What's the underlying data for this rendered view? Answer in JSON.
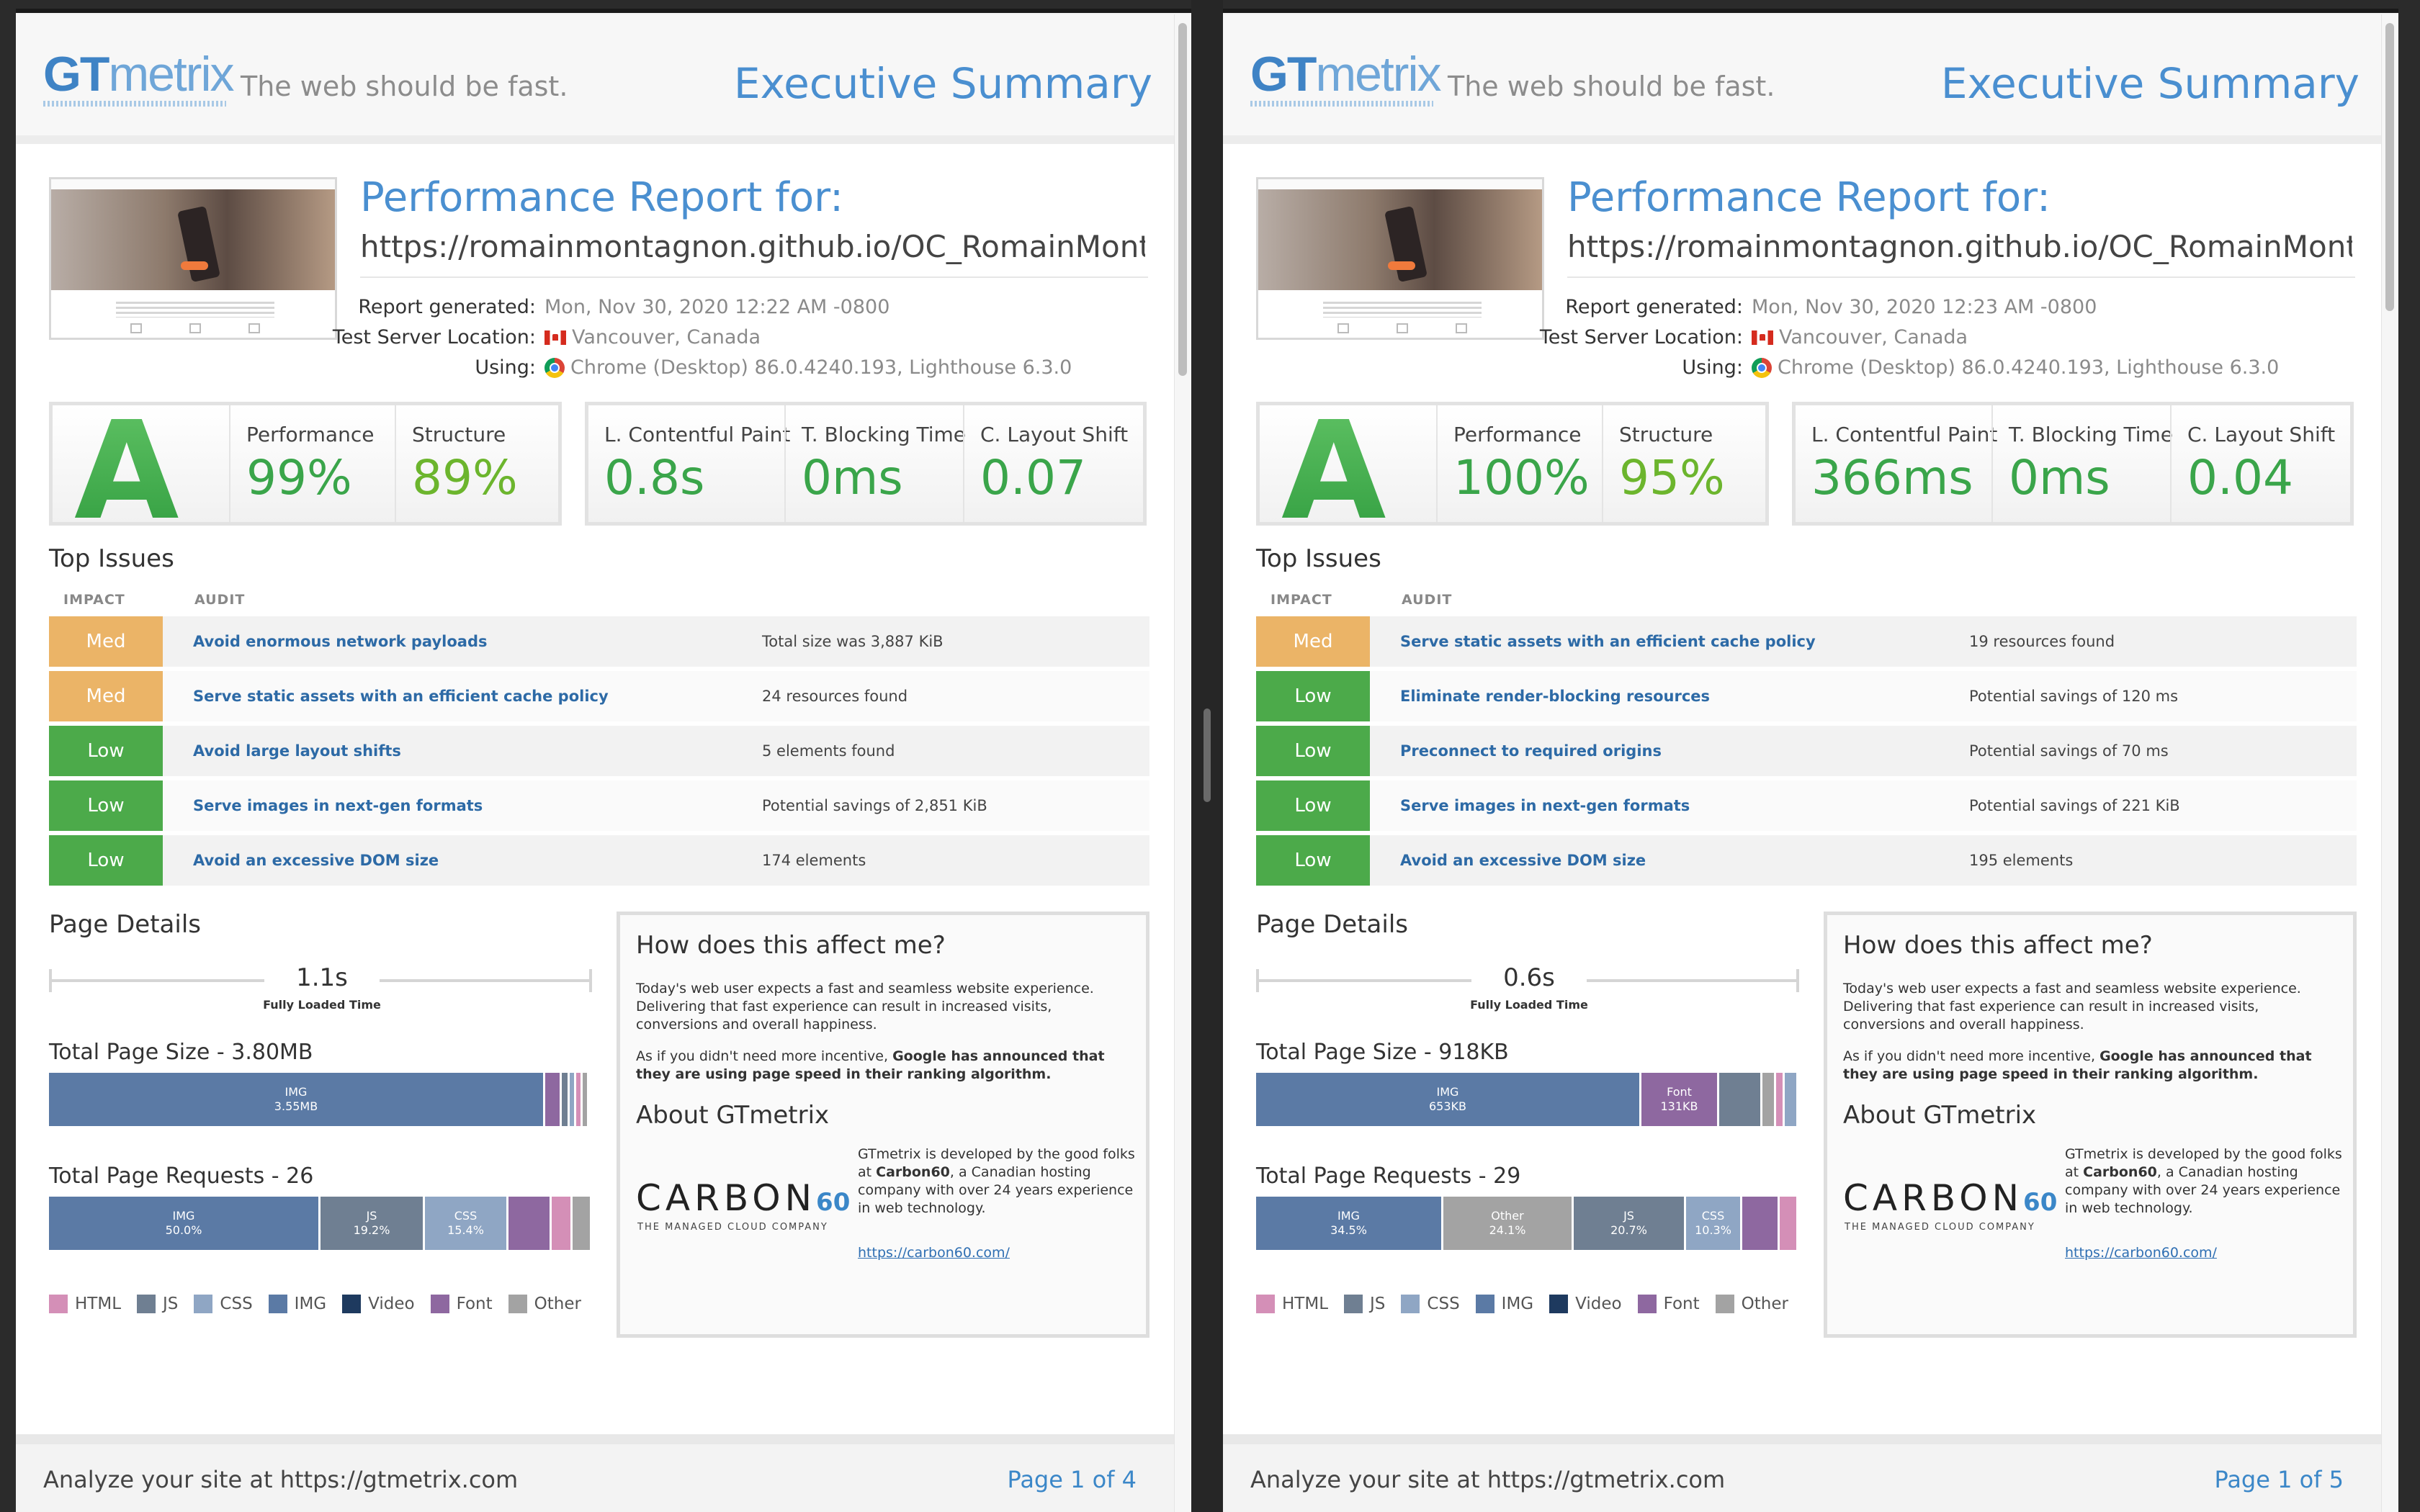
{
  "reports": [
    {
      "header": {
        "logo_gt": "GT",
        "logo_metrix": "metrix",
        "tagline": "The web should be fast.",
        "exec_title": "Executive Summary"
      },
      "report": {
        "title": "Performance Report for:",
        "url": "https://romainmontagnon.github.io/OC_RomainMontagnon_...",
        "generated_label": "Report generated:",
        "generated": "Mon, Nov 30, 2020 12:22 AM -0800",
        "location_label": "Test Server Location:",
        "location": "Vancouver, Canada",
        "using_label": "Using:",
        "using": "Chrome (Desktop) 86.0.4240.193, Lighthouse 6.3.0"
      },
      "grade": "A",
      "scores": {
        "performance_label": "Performance",
        "performance": "99%",
        "structure_label": "Structure",
        "structure": "89%"
      },
      "vitals": {
        "lcp_label": "L. Contentful Paint",
        "lcp": "0.8s",
        "tbt_label": "T. Blocking Time",
        "tbt": "0ms",
        "cls_label": "C. Layout Shift",
        "cls": "0.07"
      },
      "top_issues": {
        "title": "Top Issues",
        "impact_header": "IMPACT",
        "audit_header": "AUDIT",
        "rows": [
          {
            "impact": "Med",
            "audit": "Avoid enormous network payloads",
            "detail": "Total size was 3,887 KiB"
          },
          {
            "impact": "Med",
            "audit": "Serve static assets with an efficient cache policy",
            "detail": "24 resources found"
          },
          {
            "impact": "Low",
            "audit": "Avoid large layout shifts",
            "detail": "5 elements found"
          },
          {
            "impact": "Low",
            "audit": "Serve images in next-gen formats",
            "detail": "Potential savings of 2,851 KiB"
          },
          {
            "impact": "Low",
            "audit": "Avoid an excessive DOM size",
            "detail": "174 elements"
          }
        ]
      },
      "page_details": {
        "title": "Page Details",
        "fully_loaded": "1.1s",
        "fully_loaded_label": "Fully Loaded Time",
        "size_title": "Total Page Size - 3.80MB",
        "requests_title": "Total Page Requests - 26"
      },
      "info": {
        "affect_title": "How does this affect me?",
        "affect_p1": "Today's web user expects a fast and seamless website experience. Delivering that fast experience can result in increased visits, conversions and overall happiness.",
        "affect_p2_a": "As if you didn't need more incentive, ",
        "affect_p2_b": "Google has announced that they are using page speed in their ranking algorithm.",
        "about_title": "About GTmetrix",
        "carbon": "CARBON",
        "carbon_num": "60",
        "carbon_sub": "THE MANAGED CLOUD COMPANY",
        "about_a": "GTmetrix is developed by the good folks at ",
        "about_b": "Carbon60",
        "about_c": ", a Canadian hosting company with over 24 years experience in web technology.",
        "link": "https://carbon60.com/"
      },
      "footer": {
        "left": "Analyze your site at https://gtmetrix.com",
        "right": "Page 1 of 4"
      }
    },
    {
      "header": {
        "logo_gt": "GT",
        "logo_metrix": "metrix",
        "tagline": "The web should be fast.",
        "exec_title": "Executive Summary"
      },
      "report": {
        "title": "Performance Report for:",
        "url": "https://romainmontagnon.github.io/OC_RomainMontagnon_...",
        "generated_label": "Report generated:",
        "generated": "Mon, Nov 30, 2020 12:23 AM -0800",
        "location_label": "Test Server Location:",
        "location": "Vancouver, Canada",
        "using_label": "Using:",
        "using": "Chrome (Desktop) 86.0.4240.193, Lighthouse 6.3.0"
      },
      "grade": "A",
      "scores": {
        "performance_label": "Performance",
        "performance": "100%",
        "structure_label": "Structure",
        "structure": "95%"
      },
      "vitals": {
        "lcp_label": "L. Contentful Paint",
        "lcp": "366ms",
        "tbt_label": "T. Blocking Time",
        "tbt": "0ms",
        "cls_label": "C. Layout Shift",
        "cls": "0.04"
      },
      "top_issues": {
        "title": "Top Issues",
        "impact_header": "IMPACT",
        "audit_header": "AUDIT",
        "rows": [
          {
            "impact": "Med",
            "audit": "Serve static assets with an efficient cache policy",
            "detail": "19 resources found"
          },
          {
            "impact": "Low",
            "audit": "Eliminate render-blocking resources",
            "detail": "Potential savings of 120 ms"
          },
          {
            "impact": "Low",
            "audit": "Preconnect to required origins",
            "detail": "Potential savings of 70 ms"
          },
          {
            "impact": "Low",
            "audit": "Serve images in next-gen formats",
            "detail": "Potential savings of 221 KiB"
          },
          {
            "impact": "Low",
            "audit": "Avoid an excessive DOM size",
            "detail": "195 elements"
          }
        ]
      },
      "page_details": {
        "title": "Page Details",
        "fully_loaded": "0.6s",
        "fully_loaded_label": "Fully Loaded Time",
        "size_title": "Total Page Size - 918KB",
        "requests_title": "Total Page Requests - 29"
      },
      "info": {
        "affect_title": "How does this affect me?",
        "affect_p1": "Today's web user expects a fast and seamless website experience. Delivering that fast experience can result in increased visits, conversions and overall happiness.",
        "affect_p2_a": "As if you didn't need more incentive, ",
        "affect_p2_b": "Google has announced that they are using page speed in their ranking algorithm.",
        "about_title": "About GTmetrix",
        "carbon": "CARBON",
        "carbon_num": "60",
        "carbon_sub": "THE MANAGED CLOUD COMPANY",
        "about_a": "GTmetrix is developed by the good folks at ",
        "about_b": "Carbon60",
        "about_c": ", a Canadian hosting company with over 24 years experience in web technology.",
        "link": "https://carbon60.com/"
      },
      "footer": {
        "left": "Analyze your site at https://gtmetrix.com",
        "right": "Page 1 of 5"
      }
    }
  ],
  "legend": [
    {
      "name": "HTML",
      "color": "#d48fb7"
    },
    {
      "name": "JS",
      "color": "#6f7f92"
    },
    {
      "name": "CSS",
      "color": "#8fa6c4"
    },
    {
      "name": "IMG",
      "color": "#5b7aa5"
    },
    {
      "name": "Video",
      "color": "#1e3a5f"
    },
    {
      "name": "Font",
      "color": "#8e68a0"
    },
    {
      "name": "Other",
      "color": "#a3a3a3"
    }
  ],
  "chart_data": [
    {
      "type": "bar",
      "title": "Total Page Size - 3.80MB",
      "series": [
        {
          "name": "IMG",
          "label": "IMG",
          "value_label": "3.55MB",
          "share": 0.915
        },
        {
          "name": "Font",
          "share": 0.03
        },
        {
          "name": "JS",
          "share": 0.015
        },
        {
          "name": "CSS",
          "share": 0.012
        },
        {
          "name": "HTML",
          "share": 0.008
        },
        {
          "name": "Other",
          "share": 0.006
        }
      ]
    },
    {
      "type": "bar",
      "title": "Total Page Requests - 26",
      "series": [
        {
          "name": "IMG",
          "label": "IMG",
          "value_label": "50.0%",
          "share": 0.5
        },
        {
          "name": "JS",
          "label": "JS",
          "value_label": "19.2%",
          "share": 0.192
        },
        {
          "name": "CSS",
          "label": "CSS",
          "value_label": "15.4%",
          "share": 0.154
        },
        {
          "name": "Font",
          "share": 0.08
        },
        {
          "name": "HTML",
          "share": 0.038
        },
        {
          "name": "Other",
          "share": 0.036
        }
      ]
    },
    {
      "type": "bar",
      "title": "Total Page Size - 918KB",
      "series": [
        {
          "name": "IMG",
          "label": "IMG",
          "value_label": "653KB",
          "share": 0.711
        },
        {
          "name": "Font",
          "label": "Font",
          "value_label": "131KB",
          "share": 0.143
        },
        {
          "name": "JS",
          "share": 0.08
        },
        {
          "name": "Other",
          "share": 0.025
        },
        {
          "name": "HTML",
          "share": 0.016
        },
        {
          "name": "CSS",
          "share": 0.025
        }
      ]
    },
    {
      "type": "bar",
      "title": "Total Page Requests - 29",
      "series": [
        {
          "name": "IMG",
          "label": "IMG",
          "value_label": "34.5%",
          "share": 0.345
        },
        {
          "name": "Other",
          "label": "Other",
          "value_label": "24.1%",
          "share": 0.241
        },
        {
          "name": "JS",
          "label": "JS",
          "value_label": "20.7%",
          "share": 0.207
        },
        {
          "name": "CSS",
          "label": "CSS",
          "value_label": "10.3%",
          "share": 0.103
        },
        {
          "name": "Font",
          "share": 0.069
        },
        {
          "name": "HTML",
          "share": 0.035
        }
      ]
    }
  ]
}
